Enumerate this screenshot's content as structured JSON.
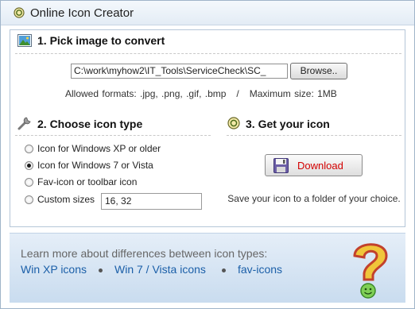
{
  "window": {
    "title": "Online Icon Creator",
    "icon": "radio-disc-icon"
  },
  "step1": {
    "heading": "1. Pick image to convert",
    "icon": "image-icon",
    "file_path": "C:\\work\\myhow2\\IT_Tools\\ServiceCheck\\SC_",
    "browse_label": "Browse..",
    "formats_text": "Allowed formats: .jpg, .png, .gif, .bmp   /   Maximum size: 1MB"
  },
  "step2": {
    "heading": "2. Choose icon type",
    "icon": "wrench-icon",
    "options": [
      {
        "label": "Icon for Windows XP or older",
        "selected": false
      },
      {
        "label": "Icon for Windows 7 or Vista",
        "selected": true
      },
      {
        "label": "Fav-icon or toolbar icon",
        "selected": false
      },
      {
        "label": "Custom sizes",
        "selected": false
      }
    ],
    "custom_sizes_value": "16, 32"
  },
  "step3": {
    "heading": "3. Get your icon",
    "icon": "radio-disc-icon",
    "download_label": "Download",
    "download_icon": "floppy-disk-icon",
    "save_text": "Save your icon to a folder of your choice."
  },
  "footer": {
    "learn_text": "Learn more about differences between icon types:",
    "links": [
      "Win XP icons",
      "Win 7 / Vista icons",
      "fav-icons"
    ],
    "mascot_icon": "question-mark-icon"
  },
  "colors": {
    "accent_link": "#1b5fa8",
    "download_text": "#d30000",
    "footer_bg": "#d6e5f4"
  }
}
